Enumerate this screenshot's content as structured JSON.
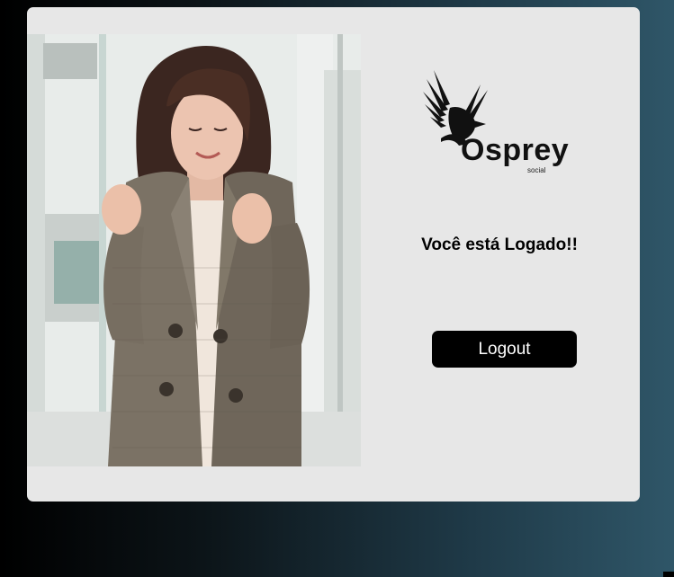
{
  "app": {
    "logo_text": "Osprey",
    "logo_subtext": "social",
    "logo_icon": "osprey-bird-icon"
  },
  "main": {
    "status_message": "Você está Logado!!",
    "logout_label": "Logout"
  },
  "colors": {
    "card_background": "#e7e7e7",
    "button_background": "#000000",
    "button_text": "#ffffff",
    "page_gradient_start": "#000000",
    "page_gradient_end": "#2f5668"
  }
}
